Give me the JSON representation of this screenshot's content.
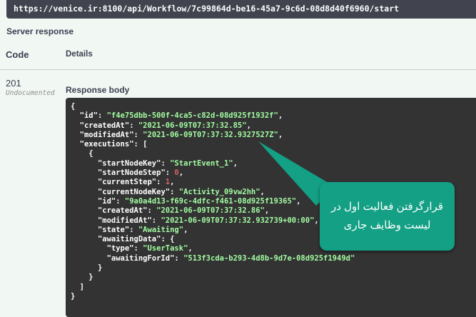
{
  "request": {
    "url": "https://venice.ir:8100/api/Workflow/7c99864d-be16-45a7-9c6d-08d8d40f6960/start"
  },
  "server_response": {
    "title": "Server response",
    "columns": {
      "code": "Code",
      "details": "Details"
    },
    "status": {
      "code": "201",
      "doc": "Undocumented"
    },
    "response_body_label": "Response body"
  },
  "response_json": [
    {
      "indent": 0,
      "parts": [
        [
          "p",
          "{"
        ]
      ]
    },
    {
      "indent": 1,
      "parts": [
        [
          "k",
          "\"id\""
        ],
        [
          "p",
          ": "
        ],
        [
          "s",
          "\"f4e75dbb-500f-4ca5-c82d-08d925f1932f\""
        ],
        [
          "p",
          ","
        ]
      ]
    },
    {
      "indent": 1,
      "parts": [
        [
          "k",
          "\"createdAt\""
        ],
        [
          "p",
          ": "
        ],
        [
          "s",
          "\"2021-06-09T07:37:32.85\""
        ],
        [
          "p",
          ","
        ]
      ]
    },
    {
      "indent": 1,
      "parts": [
        [
          "k",
          "\"modifiedAt\""
        ],
        [
          "p",
          ": "
        ],
        [
          "s",
          "\"2021-06-09T07:37:32.9327527Z\""
        ],
        [
          "p",
          ","
        ]
      ]
    },
    {
      "indent": 1,
      "parts": [
        [
          "k",
          "\"executions\""
        ],
        [
          "p",
          ": ["
        ]
      ]
    },
    {
      "indent": 2,
      "parts": [
        [
          "p",
          "{"
        ]
      ]
    },
    {
      "indent": 3,
      "parts": [
        [
          "k",
          "\"startNodeKey\""
        ],
        [
          "p",
          ": "
        ],
        [
          "s",
          "\"StartEvent_1\""
        ],
        [
          "p",
          ","
        ]
      ]
    },
    {
      "indent": 3,
      "parts": [
        [
          "k",
          "\"startNodeStep\""
        ],
        [
          "p",
          ": "
        ],
        [
          "n",
          "0"
        ],
        [
          "p",
          ","
        ]
      ]
    },
    {
      "indent": 3,
      "parts": [
        [
          "k",
          "\"currentStep\""
        ],
        [
          "p",
          ": "
        ],
        [
          "n",
          "1"
        ],
        [
          "p",
          ","
        ]
      ]
    },
    {
      "indent": 3,
      "parts": [
        [
          "k",
          "\"currentNodeKey\""
        ],
        [
          "p",
          ": "
        ],
        [
          "s",
          "\"Activity_09vw2hh\""
        ],
        [
          "p",
          ","
        ]
      ]
    },
    {
      "indent": 3,
      "parts": [
        [
          "k",
          "\"id\""
        ],
        [
          "p",
          ": "
        ],
        [
          "s",
          "\"9a0a4d13-f69c-4dfc-f461-08d925f19365\""
        ],
        [
          "p",
          ","
        ]
      ]
    },
    {
      "indent": 3,
      "parts": [
        [
          "k",
          "\"createdAt\""
        ],
        [
          "p",
          ": "
        ],
        [
          "s",
          "\"2021-06-09T07:37:32.86\""
        ],
        [
          "p",
          ","
        ]
      ]
    },
    {
      "indent": 3,
      "parts": [
        [
          "k",
          "\"modifiedAt\""
        ],
        [
          "p",
          ": "
        ],
        [
          "s",
          "\"2021-06-09T07:37:32.932739+00:00\""
        ],
        [
          "p",
          ","
        ]
      ]
    },
    {
      "indent": 3,
      "parts": [
        [
          "k",
          "\"state\""
        ],
        [
          "p",
          ": "
        ],
        [
          "s",
          "\"Awaiting\""
        ],
        [
          "p",
          ","
        ]
      ]
    },
    {
      "indent": 3,
      "parts": [
        [
          "k",
          "\"awaitingData\""
        ],
        [
          "p",
          ": {"
        ]
      ]
    },
    {
      "indent": 4,
      "parts": [
        [
          "k",
          "\"type\""
        ],
        [
          "p",
          ": "
        ],
        [
          "s",
          "\"UserTask\""
        ],
        [
          "p",
          ","
        ]
      ]
    },
    {
      "indent": 4,
      "parts": [
        [
          "k",
          "\"awaitingForId\""
        ],
        [
          "p",
          ": "
        ],
        [
          "s",
          "\"513f3cda-b293-4d8b-9d7e-08d925f1949d\""
        ]
      ]
    },
    {
      "indent": 3,
      "parts": [
        [
          "p",
          "}"
        ]
      ]
    },
    {
      "indent": 2,
      "parts": [
        [
          "p",
          "}"
        ]
      ]
    },
    {
      "indent": 1,
      "parts": [
        [
          "p",
          "]"
        ]
      ]
    },
    {
      "indent": 0,
      "parts": [
        [
          "p",
          "}"
        ]
      ]
    }
  ],
  "callout": {
    "line1": "قرارگرفتن فعالیت اول در",
    "line2": "لیست وظایف جاری",
    "color": "#13a085"
  },
  "colors": {
    "page_bg": "#f1f7f3",
    "code_bg": "#333333",
    "string": "#a2fca2",
    "number": "#d36363",
    "url_bg": "#41444e"
  }
}
